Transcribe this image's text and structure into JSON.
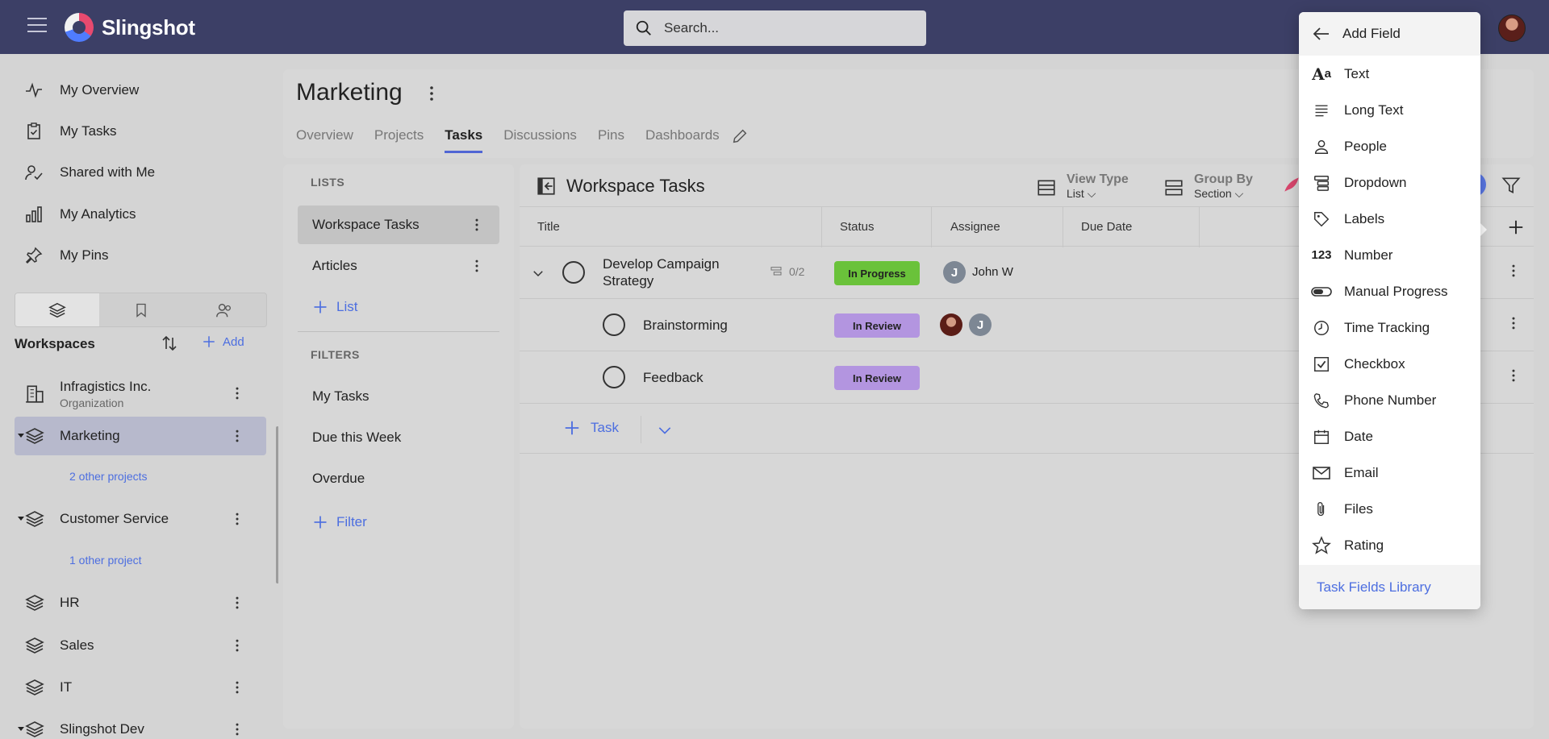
{
  "app": {
    "name": "Slingshot"
  },
  "search": {
    "placeholder": "Search..."
  },
  "sidebar": {
    "nav": [
      {
        "label": "My Overview"
      },
      {
        "label": "My Tasks"
      },
      {
        "label": "Shared with Me"
      },
      {
        "label": "My Analytics"
      },
      {
        "label": "My Pins"
      }
    ],
    "workspaces_title": "Workspaces",
    "add_label": "Add",
    "workspaces": [
      {
        "name": "Infragistics Inc.",
        "sub": "Organization"
      },
      {
        "name": "Marketing",
        "other": "2 other projects"
      },
      {
        "name": "Customer Service",
        "other": "1 other project"
      },
      {
        "name": "HR"
      },
      {
        "name": "Sales"
      },
      {
        "name": "IT"
      },
      {
        "name": "Slingshot Dev"
      }
    ]
  },
  "header": {
    "title": "Marketing",
    "tabs": [
      "Overview",
      "Projects",
      "Tasks",
      "Discussions",
      "Pins",
      "Dashboards"
    ],
    "active_tab": "Tasks"
  },
  "lists": {
    "lists_label": "LISTS",
    "items": [
      "Workspace Tasks",
      "Articles"
    ],
    "add_list": "List",
    "filters_label": "FILTERS",
    "filters": [
      "My Tasks",
      "Due this Week",
      "Overdue"
    ],
    "add_filter": "Filter"
  },
  "tasks": {
    "title": "Workspace Tasks",
    "view_type": {
      "label": "View Type",
      "value": "List"
    },
    "group_by": {
      "label": "Group By",
      "value": "Section"
    },
    "columns": [
      "Title",
      "Status",
      "Assignee",
      "Due Date"
    ],
    "rows": [
      {
        "title_line1": "Develop Campaign",
        "title_line2": "Strategy",
        "subtasks": "0/2",
        "status": "In Progress",
        "assignee_initial": "J",
        "assignee_name": "John W"
      },
      {
        "title": "Brainstorming",
        "status": "In Review",
        "assignee_initial": "J"
      },
      {
        "title": "Feedback",
        "status": "In Review"
      }
    ],
    "add_task": "Task"
  },
  "add_field": {
    "title": "Add Field",
    "items": [
      {
        "label": "Text",
        "icon": "text-icon"
      },
      {
        "label": "Long Text",
        "icon": "long-text-icon"
      },
      {
        "label": "People",
        "icon": "person-icon"
      },
      {
        "label": "Dropdown",
        "icon": "dropdown-icon"
      },
      {
        "label": "Labels",
        "icon": "tag-icon"
      },
      {
        "label": "Number",
        "icon": "number-icon",
        "glyph": "123"
      },
      {
        "label": "Manual Progress",
        "icon": "progress-icon"
      },
      {
        "label": "Time Tracking",
        "icon": "clock-icon"
      },
      {
        "label": "Checkbox",
        "icon": "checkbox-icon"
      },
      {
        "label": "Phone Number",
        "icon": "phone-icon"
      },
      {
        "label": "Date",
        "icon": "calendar-icon"
      },
      {
        "label": "Email",
        "icon": "email-icon"
      },
      {
        "label": "Files",
        "icon": "paperclip-icon"
      },
      {
        "label": "Rating",
        "icon": "star-icon"
      }
    ],
    "footer": "Task Fields Library"
  },
  "colors": {
    "topbar": "#3c3f66",
    "accent": "#4c6ee0",
    "in_progress": "#6ac23a",
    "in_review": "#b395e0"
  }
}
